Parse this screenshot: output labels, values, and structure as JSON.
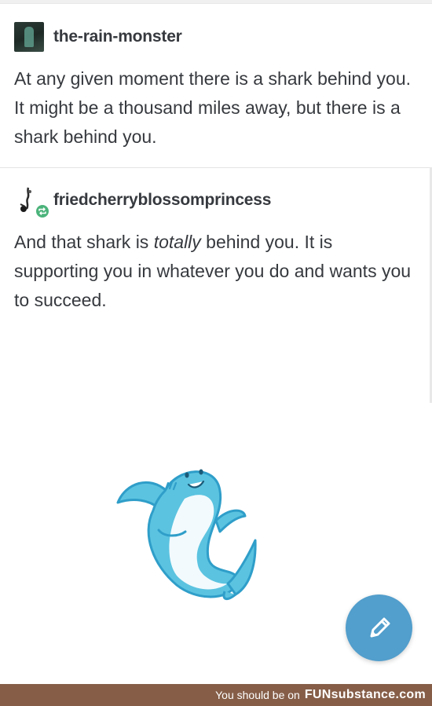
{
  "posts": [
    {
      "username": "the-rain-monster",
      "avatar_icon": "rain-monster-avatar-icon",
      "text": "At any given moment there is a shark behind you. It might be a thousand miles away, but there is a shark behind you."
    },
    {
      "username": "friedcherryblossomprincess",
      "avatar_icon": "cherry-blossom-avatar-icon",
      "badge_icon": "reblog-icon",
      "text_before": "And that shark is ",
      "text_emphasis": "totally",
      "text_after": " behind you. It is supporting you in whatever you do and wants you to succeed."
    }
  ],
  "illustration": {
    "icon": "smiling-shark-illustration",
    "color": "#5bc3e0",
    "outline": "#2f9ec9"
  },
  "compose_button": {
    "icon": "pencil-icon",
    "color": "#529ecc"
  },
  "footer": {
    "text": "You should be on",
    "brand": "FUNsubstance.com",
    "background": "#865e48"
  }
}
